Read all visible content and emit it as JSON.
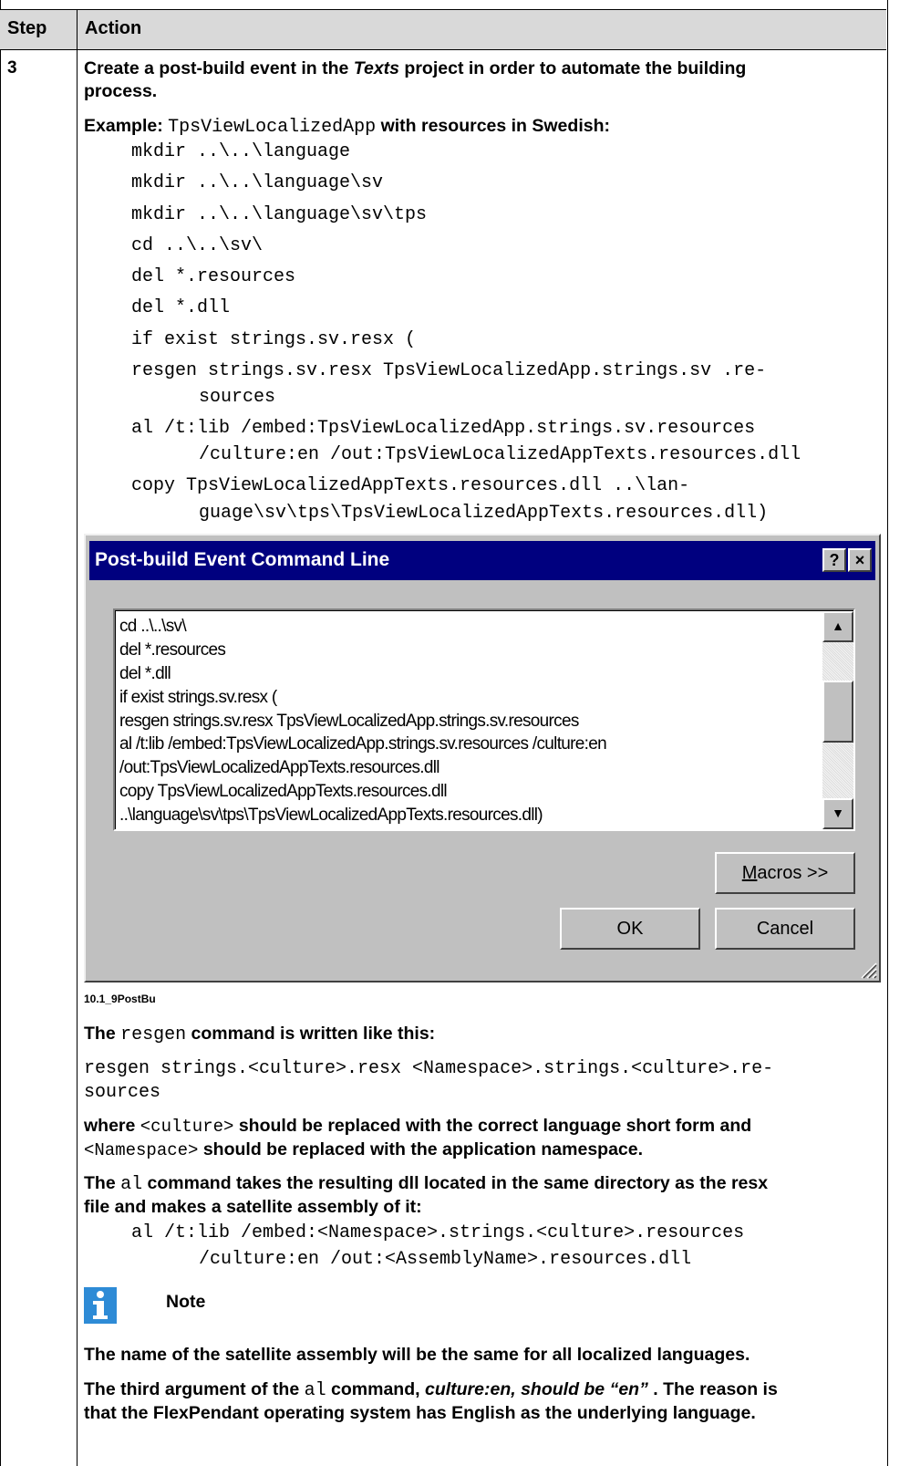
{
  "header": {
    "step": "Step",
    "action": "Action"
  },
  "step_number": "3",
  "intro": {
    "line1_a": "Create a post-build event in the ",
    "line1_italic": "Texts",
    "line1_b": " project in order to automate the building",
    "line2": "process."
  },
  "example": {
    "label": "Example: ",
    "app": "TpsViewLocalizedApp",
    "rest": " with resources in Swedish:"
  },
  "code_lines": [
    "mkdir ..\\..\\language",
    "mkdir ..\\..\\language\\sv",
    "mkdir ..\\..\\language\\sv\\tps",
    "cd ..\\..\\sv\\",
    "del *.resources",
    "del *.dll",
    "if exist strings.sv.resx (",
    "resgen strings.sv.resx TpsViewLocalizedApp.strings.sv .re-",
    "sources",
    "al /t:lib /embed:TpsViewLocalizedApp.strings.sv.resources",
    "/culture:en /out:TpsViewLocalizedAppTexts.resources.dll",
    "copy TpsViewLocalizedAppTexts.resources.dll ..\\lan-",
    "guage\\sv\\tps\\TpsViewLocalizedAppTexts.resources.dll)"
  ],
  "dialog": {
    "title": "Post-build Event Command Line",
    "help": "?",
    "close": "×",
    "lines": [
      "cd ..\\..\\sv\\",
      "del *.resources",
      "del *.dll",
      "if exist strings.sv.resx (",
      "resgen strings.sv.resx TpsViewLocalizedApp.strings.sv.resources",
      "al /t:lib /embed:TpsViewLocalizedApp.strings.sv.resources /culture:en",
      "/out:TpsViewLocalizedAppTexts.resources.dll",
      "copy TpsViewLocalizedAppTexts.resources.dll",
      "..\\language\\sv\\tps\\TpsViewLocalizedAppTexts.resources.dll)"
    ],
    "macros_m": "M",
    "macros_rest": "acros >>",
    "ok": "OK",
    "cancel": "Cancel"
  },
  "caption": "10.1_9PostBu",
  "resgen_para": {
    "a": "The ",
    "cmd": "resgen",
    "b": " command is written like this:"
  },
  "resgen_syntax": [
    "resgen strings.<culture>.resx <Namespace>.strings.<culture>.re-",
    "sources"
  ],
  "where_para": {
    "a": "where ",
    "culture": "<culture>",
    "b": " should be replaced with the correct language short form and",
    "ns": "<Namespace>",
    "c": " should be replaced with the application namespace."
  },
  "al_para": {
    "a": "The ",
    "cmd": "al",
    "b": " command takes the resulting dll located in the same directory as the resx",
    "line2": "file and makes a satellite assembly of it:"
  },
  "al_syntax": [
    "al /t:lib /embed:<Namespace>.strings.<culture>.resources",
    "/culture:en /out:<AssemblyName>.resources.dll"
  ],
  "note": {
    "icon": "i",
    "heading": "Note",
    "p1": "The name of the satellite assembly will be the same for all localized languages.",
    "p2_a": "The third argument of the ",
    "p2_cmd": "al",
    "p2_b": " command, ",
    "p2_italic": "culture:en, should be “en”",
    "p2_c": " . The reason is",
    "p3": "that the FlexPendant operating system has English as the underlying language."
  },
  "colors": {
    "header_bg": "#d9d9d9",
    "titlebar": "#00007f",
    "dialog_bg": "#c0c0c0",
    "note_icon": "#2e8bd6"
  }
}
